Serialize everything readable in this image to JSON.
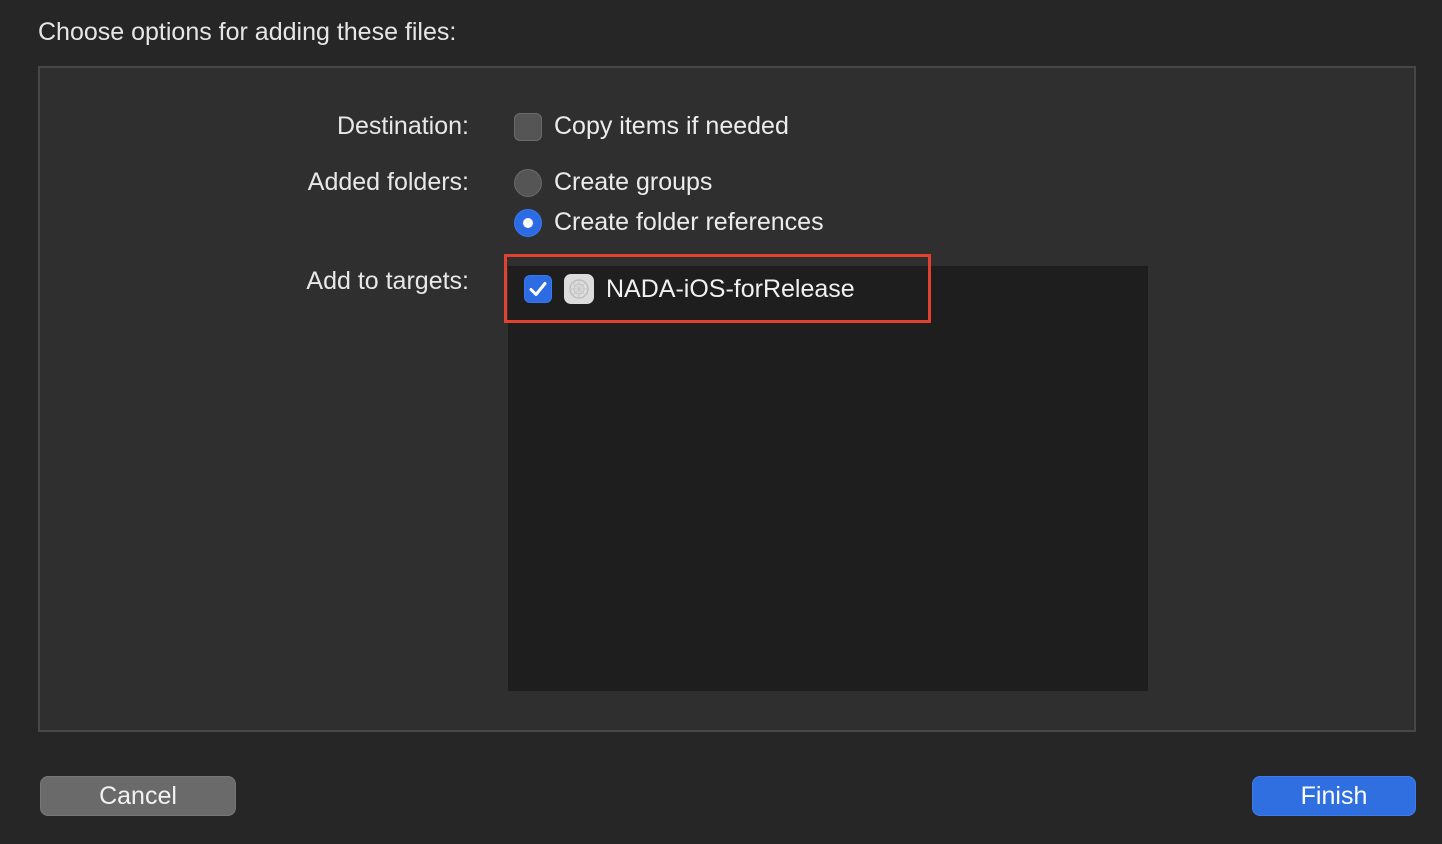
{
  "dialog": {
    "title": "Choose options for adding these files:"
  },
  "destination": {
    "label": "Destination:",
    "copy_items_label": "Copy items if needed",
    "copy_items_checked": false
  },
  "added_folders": {
    "label": "Added folders:",
    "options": [
      {
        "label": "Create groups",
        "selected": false
      },
      {
        "label": "Create folder references",
        "selected": true
      }
    ]
  },
  "targets": {
    "label": "Add to targets:",
    "items": [
      {
        "name": "NADA-iOS-forRelease",
        "checked": true,
        "icon": "app-target-icon"
      }
    ]
  },
  "buttons": {
    "cancel_label": "Cancel",
    "finish_label": "Finish"
  },
  "colors": {
    "accent": "#2d6be4",
    "highlight": "#e2422d",
    "background": "#262626",
    "panel": "#2f2f2f",
    "list": "#1e1e1e"
  }
}
